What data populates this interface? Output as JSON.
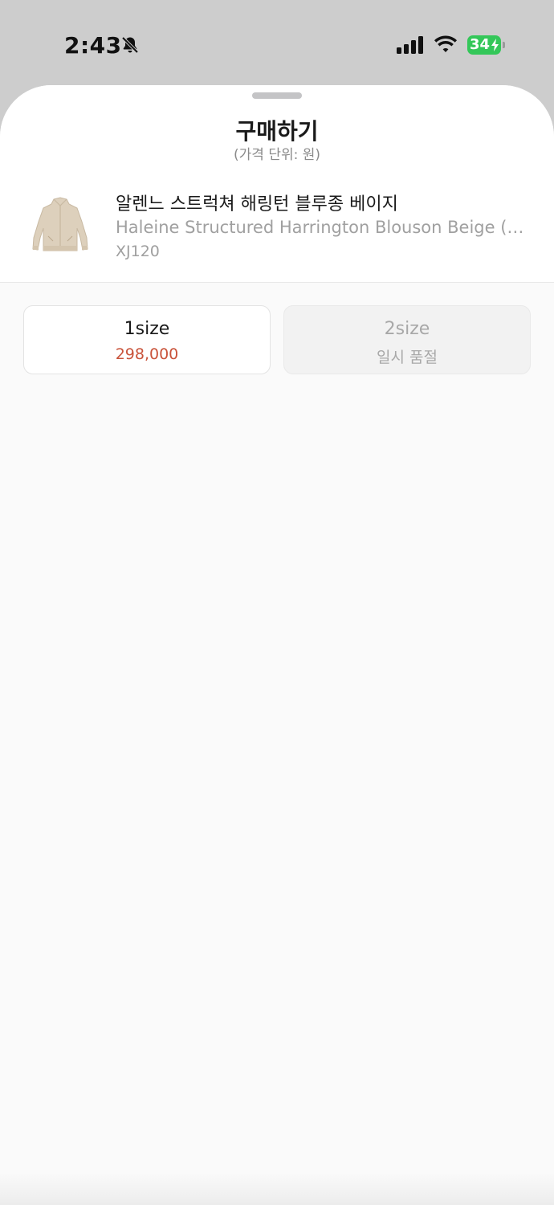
{
  "status_bar": {
    "time": "2:43",
    "battery": "34",
    "battery_color": "#34c759",
    "icons": [
      "bell-slash-icon",
      "cellular-signal-icon",
      "wifi-icon",
      "battery-charging-icon"
    ]
  },
  "sheet": {
    "title": "구매하기",
    "subtitle": "(가격 단위: 원)"
  },
  "product": {
    "name_ko": "알렌느 스트럭쳐 해링턴 블루종 베이지",
    "name_en": "Haleine Structured Harrington Blouson Beige (XJ120)",
    "code": "XJ120",
    "thumbnail_icon": "jacket-thumbnail"
  },
  "options": [
    {
      "label": "1size",
      "sub": "298,000",
      "available": true
    },
    {
      "label": "2size",
      "sub": "일시 품절",
      "available": false
    }
  ],
  "colors": {
    "price": "#c9533a",
    "sold_out": "#a8a8a8"
  }
}
